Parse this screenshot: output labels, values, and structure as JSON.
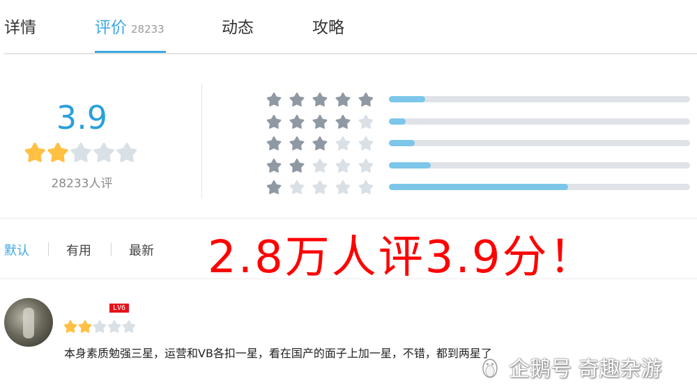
{
  "tabs": [
    {
      "label": "详情"
    },
    {
      "label": "评价",
      "count": "28233"
    },
    {
      "label": "动态"
    },
    {
      "label": "攻略"
    }
  ],
  "rating": {
    "score": "3.9",
    "count_text": "28233人评",
    "stars_filled": 2,
    "stars_total": 5
  },
  "distribution": [
    {
      "stars": 5,
      "fraction": 0.12
    },
    {
      "stars": 4,
      "fraction": 0.055
    },
    {
      "stars": 3,
      "fraction": 0.085
    },
    {
      "stars": 2,
      "fraction": 0.14
    },
    {
      "stars": 1,
      "fraction": 0.595
    }
  ],
  "filters": [
    {
      "label": "默认"
    },
    {
      "label": "有用"
    },
    {
      "label": "最新"
    }
  ],
  "overlay_title": "2.8万人评3.9分！",
  "review": {
    "level": "LV6",
    "stars_filled": 2,
    "stars_total": 5,
    "text": "本身素质勉强三星，运营和VB各扣一星，看在国产的面子上加一星，不错，都到两星了"
  },
  "watermark": "企鹅号 奇趣杂游",
  "colors": {
    "accent": "#3da7e2",
    "star_gold": "#ffc043",
    "star_empty": "#d9e0e6",
    "star_dark": "#8f99a3",
    "headline": "#ff0000"
  }
}
